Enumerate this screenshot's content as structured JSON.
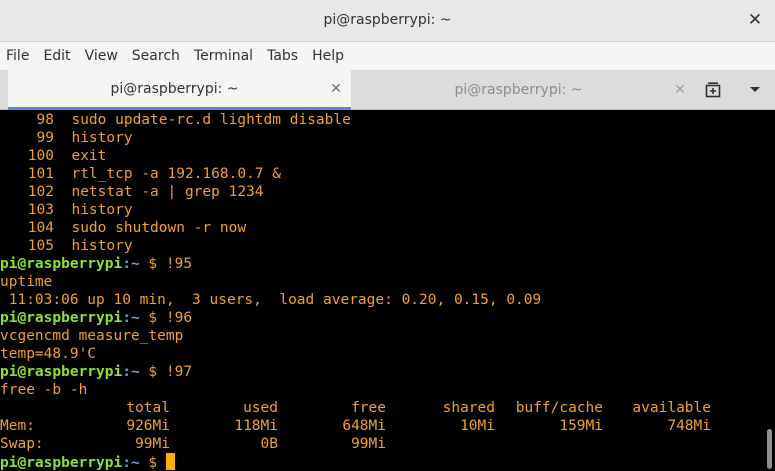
{
  "window": {
    "title": "pi@raspberrypi: ~"
  },
  "menubar": {
    "items": [
      "File",
      "Edit",
      "View",
      "Search",
      "Terminal",
      "Tabs",
      "Help"
    ]
  },
  "tabs": [
    {
      "label": "pi@raspberrypi: ~",
      "active": true
    },
    {
      "label": "pi@raspberrypi: ~",
      "active": false
    }
  ],
  "terminal": {
    "prompt_user": "pi@raspberrypi",
    "prompt_path": ":~",
    "prompt_symbol": " $ ",
    "history": [
      {
        "num": "98",
        "cmd": "sudo update-rc.d lightdm disable"
      },
      {
        "num": "99",
        "cmd": "history"
      },
      {
        "num": "100",
        "cmd": "exit"
      },
      {
        "num": "101",
        "cmd": "rtl_tcp -a 192.168.0.7 &"
      },
      {
        "num": "102",
        "cmd": "netstat -a | grep 1234"
      },
      {
        "num": "103",
        "cmd": "history"
      },
      {
        "num": "104",
        "cmd": "sudo shutdown -r now"
      },
      {
        "num": "105",
        "cmd": "history"
      }
    ],
    "session": [
      {
        "command": "!95",
        "output": [
          "uptime",
          " 11:03:06 up 10 min,  3 users,  load average: 0.20, 0.15, 0.09"
        ]
      },
      {
        "command": "!96",
        "output": [
          "vcgencmd measure_temp",
          "temp=48.9'C"
        ]
      },
      {
        "command": "!97",
        "output": [
          "free -b -h"
        ]
      }
    ],
    "free_table": {
      "headers": [
        "total",
        "used",
        "free",
        "shared",
        "buff/cache",
        "available"
      ],
      "rows": [
        {
          "label": "Mem:",
          "values": [
            "926Mi",
            "118Mi",
            "648Mi",
            "10Mi",
            "159Mi",
            "748Mi"
          ]
        },
        {
          "label": "Swap:",
          "values": [
            "99Mi",
            "0B",
            "99Mi",
            "",
            "",
            ""
          ]
        }
      ]
    }
  }
}
